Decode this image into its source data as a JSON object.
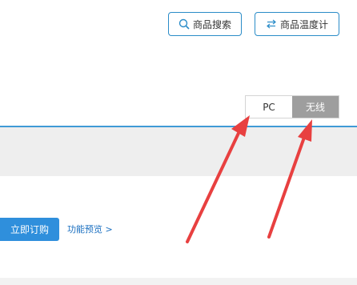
{
  "header": {
    "search_button_label": "商品搜索",
    "temperature_button_label": "商品温度计",
    "search_icon": "search-icon",
    "temperature_icon": "swap-arrows-icon"
  },
  "device_toggle": {
    "pc_label": "PC",
    "wireless_label": "无线",
    "selected": "无线"
  },
  "actions": {
    "order_button_label": "立即订购",
    "preview_link_label": "功能预览",
    "preview_link_suffix": ">"
  },
  "annotations": {
    "arrow_color": "#e84040"
  },
  "colors": {
    "accent_blue": "#2f8fdc",
    "divider_blue": "#3f9ad6",
    "toggle_selected": "#9e9e9e"
  }
}
